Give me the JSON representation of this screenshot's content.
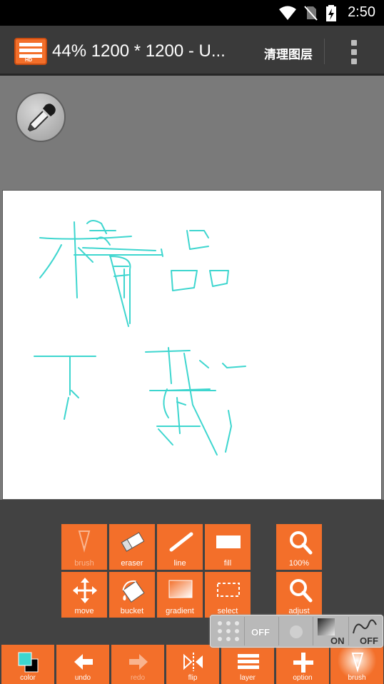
{
  "status_bar": {
    "time": "2:50",
    "icons": [
      "wifi-icon",
      "no-sim-icon",
      "battery-charging-icon"
    ]
  },
  "app_bar": {
    "title": "44% 1200 * 1200 - U...",
    "action": "清理图层",
    "logo_badge": "HD"
  },
  "tools": [
    {
      "id": "brush",
      "label": "brush",
      "icon": "brush-icon",
      "active": false
    },
    {
      "id": "eraser",
      "label": "eraser",
      "icon": "eraser-icon"
    },
    {
      "id": "line",
      "label": "line",
      "icon": "line-icon"
    },
    {
      "id": "fill",
      "label": "fill",
      "icon": "fill-rect-icon"
    },
    {
      "id": "zoom",
      "label": "100%",
      "icon": "zoom-icon"
    },
    {
      "id": "move",
      "label": "move",
      "icon": "move-icon"
    },
    {
      "id": "bucket",
      "label": "bucket",
      "icon": "bucket-icon"
    },
    {
      "id": "gradient",
      "label": "gradient",
      "icon": "gradient-icon"
    },
    {
      "id": "select",
      "label": "select",
      "icon": "select-icon"
    },
    {
      "id": "adjust",
      "label": "adjust",
      "icon": "adjust-icon"
    }
  ],
  "quick_panel": {
    "grid_state": "OFF",
    "snap_state": "ON",
    "stabilizer_state": "OFF"
  },
  "bottom_bar": [
    {
      "id": "color",
      "label": "color"
    },
    {
      "id": "undo",
      "label": "undo"
    },
    {
      "id": "redo",
      "label": "redo"
    },
    {
      "id": "flip",
      "label": "flip"
    },
    {
      "id": "layer",
      "label": "layer"
    },
    {
      "id": "option",
      "label": "option"
    },
    {
      "id": "brush",
      "label": "brush"
    }
  ],
  "colors": {
    "accent": "#f36f2a",
    "stroke": "#3ed6cf",
    "foreground": "#3ed6cf",
    "background": "#000000"
  }
}
